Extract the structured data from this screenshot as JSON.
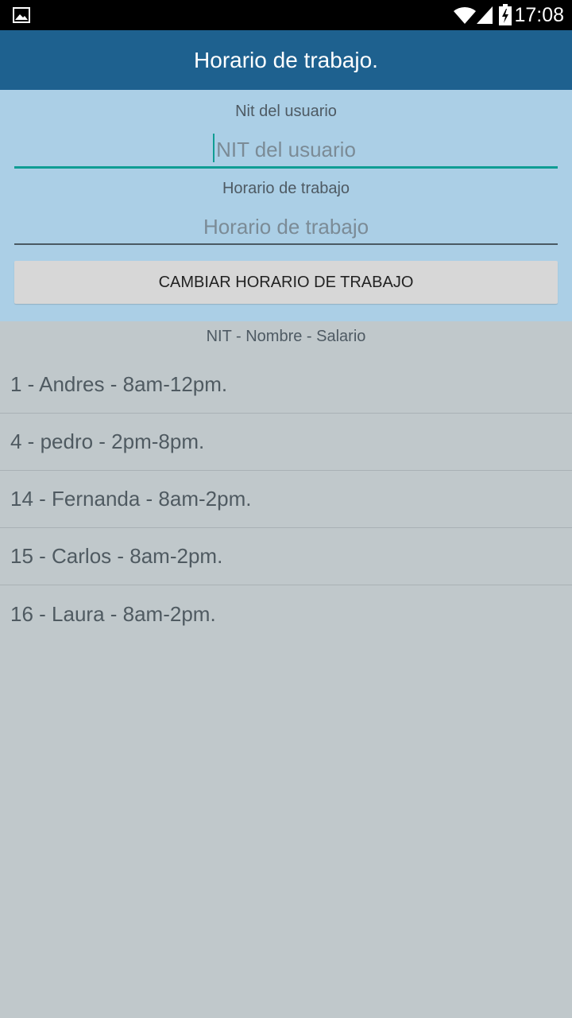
{
  "status_bar": {
    "time": "17:08",
    "icons": [
      "gallery-icon",
      "wifi-icon",
      "signal-icon",
      "battery-charging-icon"
    ]
  },
  "app_bar": {
    "title": "Horario de trabajo."
  },
  "form": {
    "nit_label": "Nit del usuario",
    "nit_placeholder": "NIT del usuario",
    "nit_value": "",
    "schedule_label": "Horario de trabajo",
    "schedule_placeholder": "Horario de trabajo",
    "schedule_value": "",
    "button_label": "CAMBIAR HORARIO DE TRABAJO"
  },
  "list": {
    "header": "NIT - Nombre - Salario",
    "items": [
      "1 - Andres - 8am-12pm.",
      "4 - pedro - 2pm-8pm.",
      "14 - Fernanda - 8am-2pm.",
      "15 - Carlos - 8am-2pm.",
      "16 - Laura - 8am-2pm."
    ]
  },
  "colors": {
    "app_bar": "#1e618f",
    "form_panel": "#abcfe6",
    "list_background": "#c0c8cb",
    "focus_accent": "#0f9d94",
    "button": "#d7d7d7"
  }
}
